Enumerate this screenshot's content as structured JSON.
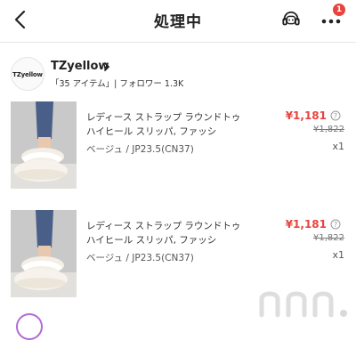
{
  "header": {
    "title": "処理中",
    "notification_count": "1"
  },
  "shop": {
    "logo_text": "TZyellow",
    "name": "TZyellow",
    "meta": "「35 アイテム」| フォロワー 1.3K"
  },
  "items": [
    {
      "title": "レディース ストラップ ラウンドトゥ ハイヒール スリッパ, ファッシ",
      "variant": "ベージュ / JP23.5(CN37)",
      "price": "¥1,181",
      "original_price": "¥1,822",
      "quantity": "x1"
    },
    {
      "title": "レディース ストラップ ラウンドトゥ ハイヒール スリッパ, ファッシ",
      "variant": "ベージュ / JP23.5(CN37)",
      "price": "¥1,181",
      "original_price": "¥1,822",
      "quantity": "x1"
    }
  ],
  "colors": {
    "price": "#e8433e",
    "badge": "#e8433e"
  }
}
